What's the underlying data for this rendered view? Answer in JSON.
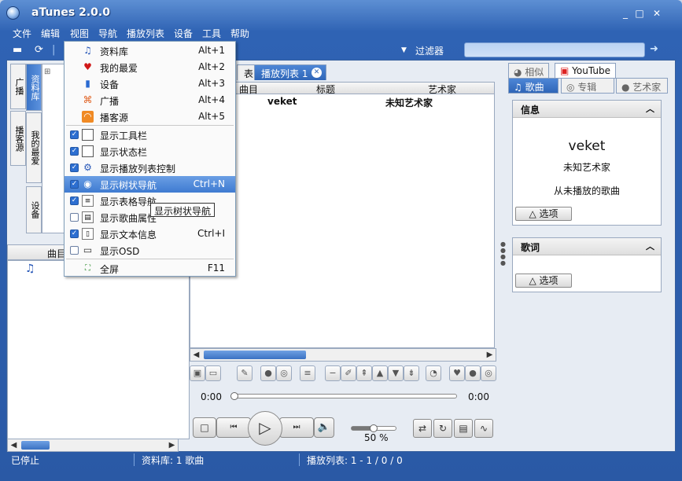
{
  "window": {
    "title": "aTunes 2.0.0",
    "controls": [
      "_",
      "□",
      "✕"
    ]
  },
  "menubar": [
    "文件",
    "编辑",
    "视图",
    "导航",
    "播放列表",
    "设备",
    "工具",
    "帮助"
  ],
  "toolbar": {
    "filter_label": "过滤器",
    "filter_value": ""
  },
  "view_menu": {
    "items": [
      {
        "icon": "music-note-icon",
        "label": "资料库",
        "shortcut": "Alt+1"
      },
      {
        "icon": "heart-icon",
        "label": "我的最爱",
        "shortcut": "Alt+2"
      },
      {
        "icon": "device-icon",
        "label": "设备",
        "shortcut": "Alt+3"
      },
      {
        "icon": "radio-icon",
        "label": "广播",
        "shortcut": "Alt+4"
      },
      {
        "icon": "rss-icon",
        "label": "播客源",
        "shortcut": "Alt+5"
      },
      {
        "icon": "window-icon",
        "label": "显示工具栏",
        "shortcut": "",
        "checked": true
      },
      {
        "icon": "window-icon",
        "label": "显示状态栏",
        "shortcut": "",
        "checked": true
      },
      {
        "icon": "gear-icon",
        "label": "显示播放列表控制",
        "shortcut": "",
        "checked": true
      },
      {
        "icon": "tree-icon",
        "label": "显示树状导航",
        "shortcut": "Ctrl+N",
        "checked": true
      },
      {
        "icon": "table-icon",
        "label": "显示表格导航",
        "shortcut": "",
        "checked": true
      },
      {
        "icon": "properties-icon",
        "label": "显示歌曲属性",
        "shortcut": "",
        "checked": false
      },
      {
        "icon": "text-icon",
        "label": "显示文本信息",
        "shortcut": "Ctrl+I",
        "checked": true
      },
      {
        "icon": "monitor-icon",
        "label": "显示OSD",
        "shortcut": "",
        "checked": false
      },
      {
        "icon": "fullscreen-icon",
        "label": "全屏",
        "shortcut": "F11"
      }
    ],
    "tooltip": "显示树状导航"
  },
  "left_tabs": [
    "广播",
    "播客源",
    "资料库",
    "我的最爱",
    "设备"
  ],
  "left_list": {
    "column": "曲目"
  },
  "center": {
    "tabs": [
      "表",
      "播放列表 1"
    ],
    "columns": [
      "曲目",
      "标题",
      "艺术家"
    ],
    "rows": [
      {
        "track": "",
        "title": "veket",
        "artist": "未知艺术家"
      }
    ],
    "time_start": "0:00",
    "time_end": "0:00",
    "volume_label": "50 %",
    "volume": 0.5
  },
  "right": {
    "tabs_top": [
      "相似",
      "YouTube"
    ],
    "tabs_bottom": [
      "歌曲",
      "专辑",
      "艺术家"
    ],
    "info": {
      "heading": "信息",
      "title": "veket",
      "artist": "未知艺术家",
      "source": "从未播放的歌曲",
      "options": "选项"
    },
    "lyrics": {
      "heading": "歌词",
      "options": "选项"
    }
  },
  "status": {
    "state": "已停止",
    "library": "资料库: 1 歌曲",
    "playlist": "播放列表: 1 - 1 / 0 / 0"
  }
}
